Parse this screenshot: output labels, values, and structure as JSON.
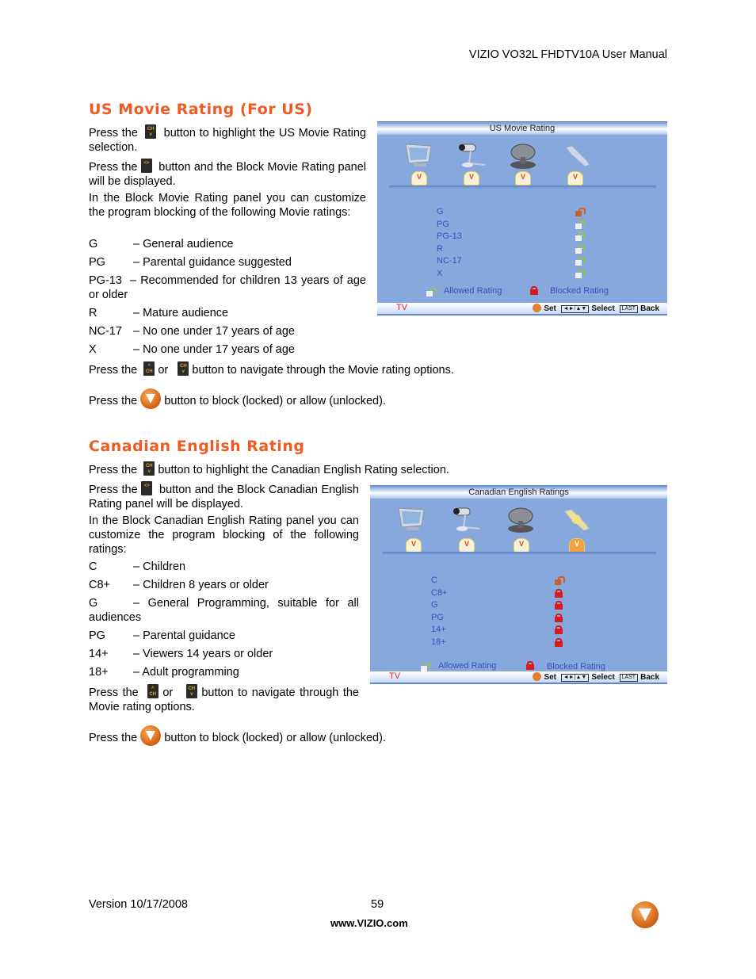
{
  "header": {
    "title": "VIZIO VO32L FHDTV10A User Manual"
  },
  "us_section": {
    "title": "US Movie Rating (For US)",
    "p1_pre": "Press the",
    "p1_post": "button to highlight the US Movie Rating selection.",
    "p2_pre": "Press the",
    "p2_post": "button and the Block Movie Rating panel will be displayed.",
    "p3": "In the Block Movie Rating panel you can customize the program blocking of the following Movie ratings:",
    "ratings": [
      {
        "code": "G",
        "desc": "– General audience"
      },
      {
        "code": "PG",
        "desc": "– Parental guidance suggested"
      },
      {
        "code": "PG-13",
        "desc": "– Recommended for children 13 years of age or older"
      },
      {
        "code": "R",
        "desc": "– Mature audience"
      },
      {
        "code": "NC-17",
        "desc": "– No one under 17 years of age"
      },
      {
        "code": "X",
        "desc": "– No one under 17 years of age"
      }
    ],
    "nav_pre": "Press the",
    "nav_or": "or",
    "nav_post": "button to navigate through the Movie rating options.",
    "block_pre": "Press the",
    "block_post": "button to block (locked) or allow (unlocked).",
    "panel": {
      "title": "US  Movie Rating",
      "items": [
        {
          "label": "G",
          "state": "unlocked-selected"
        },
        {
          "label": "PG",
          "state": "allowed"
        },
        {
          "label": "PG-13",
          "state": "allowed"
        },
        {
          "label": "R",
          "state": "allowed"
        },
        {
          "label": "NC-17",
          "state": "allowed"
        },
        {
          "label": "X",
          "state": "allowed"
        }
      ],
      "legend_allowed": "Allowed Rating",
      "legend_blocked": "Blocked Rating",
      "source": "TV",
      "hint_set": "Set",
      "hint_select": "Select",
      "hint_last_key": "LAST",
      "hint_back": "Back",
      "menu_icons": [
        "tv-icon",
        "microphone-icon",
        "satellite-dish-icon",
        "wrench-icon"
      ]
    }
  },
  "ca_section": {
    "title": "Canadian English Rating",
    "p1_pre": "Press the",
    "p1_post": "button to highlight the Canadian English Rating selection.",
    "p2_pre": "Press the",
    "p2_post": "button and the Block Canadian English Rating panel will be displayed.",
    "p3": "In the Block Canadian English Rating panel you can customize the program blocking of the following ratings:",
    "ratings": [
      {
        "code": "C",
        "desc": "– Children"
      },
      {
        "code": "C8+",
        "desc": "– Children 8 years or older"
      },
      {
        "code": "G",
        "desc": "– General Programming, suitable for all audiences"
      },
      {
        "code": "PG",
        "desc": "– Parental guidance"
      },
      {
        "code": "14+",
        "desc": "– Viewers 14 years or older"
      },
      {
        "code": "18+",
        "desc": "– Adult programming"
      }
    ],
    "nav_pre": "Press the",
    "nav_or": "or",
    "nav_post": "button to navigate through the Movie rating options.",
    "block_pre": "Press the",
    "block_post": "button to block (locked) or allow (unlocked).",
    "panel": {
      "title": "Canadian English Ratings",
      "items": [
        {
          "label": "C",
          "state": "unlocked-selected"
        },
        {
          "label": "C8+",
          "state": "blocked"
        },
        {
          "label": "G",
          "state": "blocked"
        },
        {
          "label": "PG",
          "state": "blocked"
        },
        {
          "label": "14+",
          "state": "blocked"
        },
        {
          "label": "18+",
          "state": "blocked"
        }
      ],
      "legend_allowed": "Allowed Rating",
      "legend_blocked": "Blocked Rating",
      "source": "TV",
      "hint_set": "Set",
      "hint_select": "Select",
      "hint_last_key": "LAST",
      "hint_back": "Back",
      "menu_icons": [
        "tv-icon",
        "microphone-icon",
        "satellite-dish-icon",
        "wrench-icon"
      ]
    }
  },
  "footer": {
    "version": "Version 10/17/2008",
    "page": "59",
    "url": "www.VIZIO.com"
  },
  "colors": {
    "section_title": "#f15a22",
    "panel_bg": "#86a8dc",
    "panel_text": "#3a4fb8",
    "blocked_lock": "#d81c1c"
  }
}
